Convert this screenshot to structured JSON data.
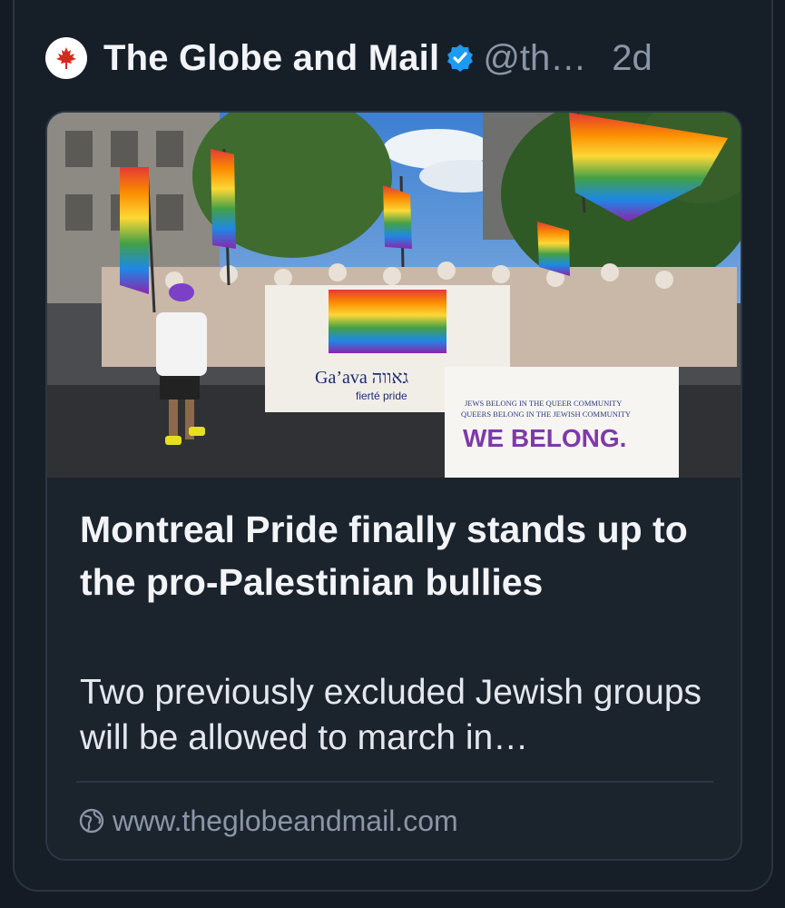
{
  "post": {
    "author": "The Globe and Mail",
    "handle": "@th…",
    "time": "2d",
    "avatar_icon": "maple-leaf-icon",
    "verified_icon": "verified-badge-icon"
  },
  "card": {
    "image_banner_1": "Ga’ava גאווה",
    "image_banner_1_sub": "fierté pride",
    "image_banner_2_line1": "JEWS BELONG IN THE QUEER COMMUNITY",
    "image_banner_2_line2": "QUEERS BELONG IN THE JEWISH COMMUNITY",
    "image_banner_2_slogan": "WE BELONG.",
    "title": "Montreal Pride finally stands up to the pro-Palestinian bullies",
    "description": "Two previously excluded Jewish groups will be allowed to march in…",
    "domain": "www.theglobeandmail.com",
    "domain_icon": "globe-icon"
  },
  "colors": {
    "background": "#141b24",
    "verified": "#1d9bf0",
    "brand_red": "#d52b1e"
  }
}
